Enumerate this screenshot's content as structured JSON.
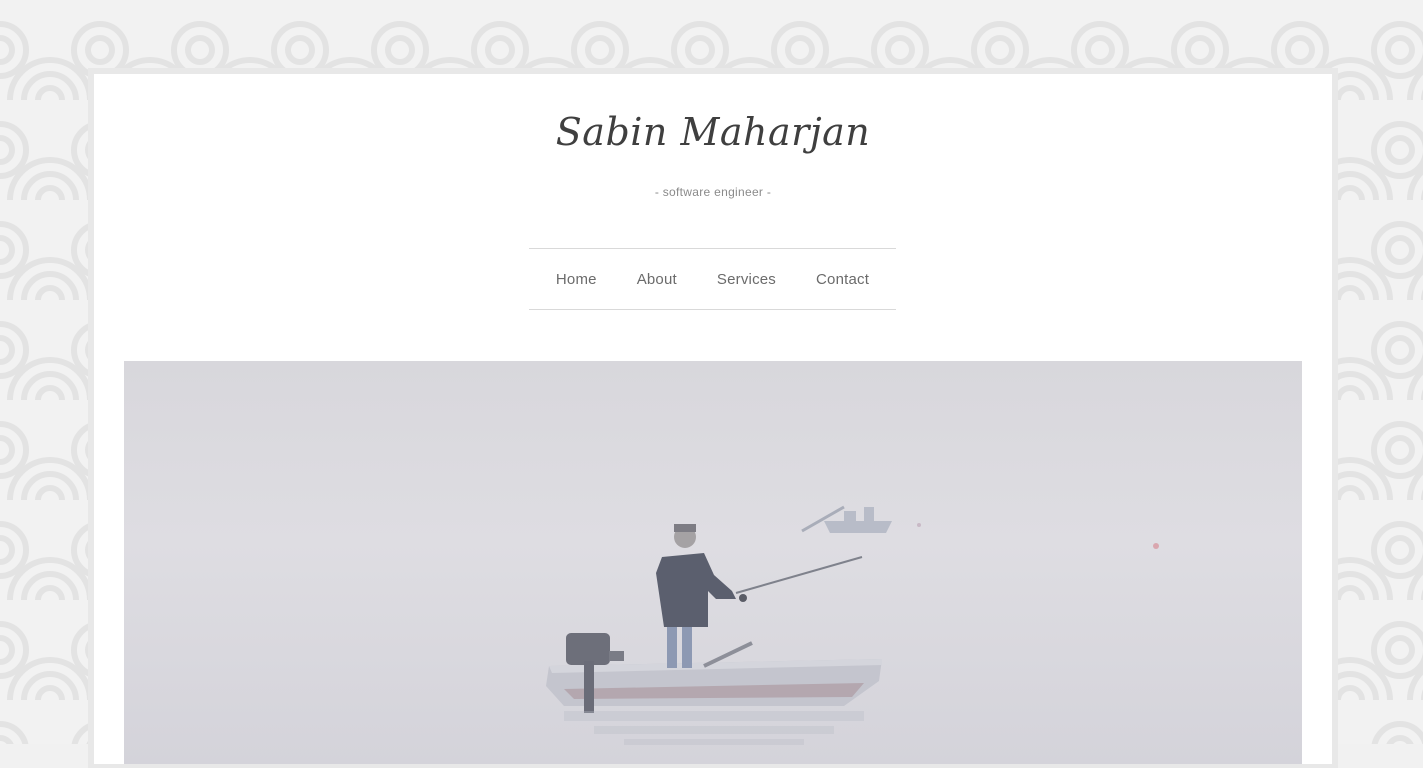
{
  "site": {
    "title": "Sabin Maharjan",
    "tagline": "- software engineer -"
  },
  "nav": {
    "items": [
      {
        "label": "Home"
      },
      {
        "label": "About"
      },
      {
        "label": "Services"
      },
      {
        "label": "Contact"
      }
    ]
  },
  "hero": {
    "image": "misty-lake-fisherman-photo"
  },
  "colors": {
    "page_background": "#f1f1f1",
    "card": "#ffffff",
    "title_text": "#3f3f3f",
    "nav_text": "#6b6b6b",
    "divider": "#d9d9d9"
  }
}
